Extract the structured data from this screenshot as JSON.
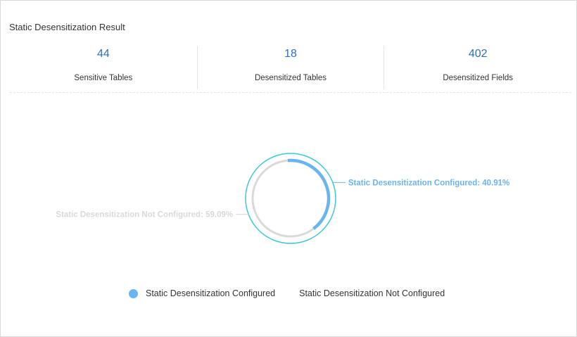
{
  "panel": {
    "title": "Static Desensitization Result"
  },
  "stats": [
    {
      "value": "44",
      "label": "Sensitive Tables"
    },
    {
      "value": "18",
      "label": "Desensitized Tables"
    },
    {
      "value": "402",
      "label": "Desensitized Fields"
    }
  ],
  "colors": {
    "configured": "#6ab4f0",
    "not_configured": "#d9d9d9",
    "outer_ring": "#40c8d6",
    "stat_value": "#2f6fb8"
  },
  "chart_data": {
    "type": "pie",
    "style": "ring",
    "slices": [
      {
        "name": "Static Desensitization Configured",
        "value": 40.91,
        "label": "Static Desensitization Configured: 40.91%"
      },
      {
        "name": "Static Desensitization Not Configured",
        "value": 59.09,
        "label": "Static Desensitization Not Configured: 59.09%"
      }
    ],
    "legend": {
      "placement": "bottom",
      "items": [
        "Static Desensitization Configured",
        "Static Desensitization Not Configured"
      ]
    }
  }
}
